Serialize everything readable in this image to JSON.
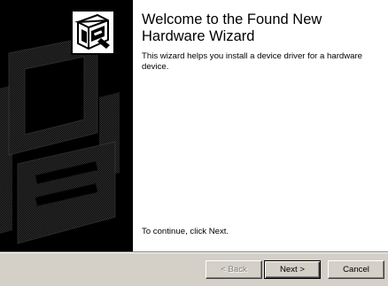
{
  "wizard": {
    "title": "Welcome to the Found New Hardware Wizard",
    "description": "This wizard helps you install a device driver for a hardware device.",
    "continue_text": "To continue, click Next."
  },
  "buttons": {
    "back_label": "< Back",
    "next_label": "Next >",
    "cancel_label": "Cancel",
    "back_enabled": false
  },
  "icons": {
    "wizard_icon": "hardware-wizard-icon",
    "left_art": "hardware-board-watermark"
  },
  "colors": {
    "dialog_face": "#d4d0c8",
    "left_panel": "#000000",
    "content_background": "#ffffff",
    "disabled_text": "#808080"
  }
}
